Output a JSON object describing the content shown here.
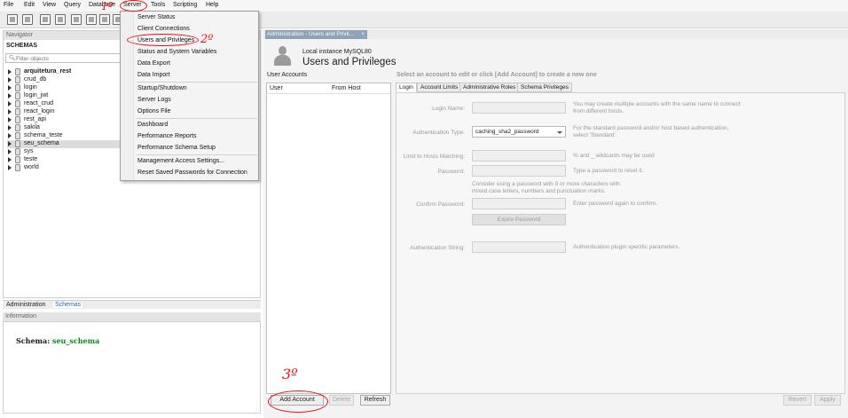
{
  "menubar": {
    "items": [
      "File",
      "Edit",
      "View",
      "Query",
      "Database",
      "Server",
      "Tools",
      "Scripting",
      "Help"
    ]
  },
  "server_menu": {
    "items": [
      "Server Status",
      "Client Connections",
      "Users and Privileges",
      "Status and System Variables",
      "Data Export",
      "Data Import",
      "Startup/Shutdown",
      "Server Logs",
      "Options File",
      "Dashboard",
      "Performance Reports",
      "Performance Schema Setup",
      "Management Access Settings...",
      "Reset Saved Passwords for Connection"
    ]
  },
  "navigator": {
    "header": "Navigator",
    "schemas_label": "SCHEMAS",
    "filter_placeholder": "Filter objects",
    "schemas": [
      "arquitetura_rest",
      "crud_db",
      "login",
      "login_jwt",
      "react_crud",
      "react_login",
      "rest_api",
      "sakila",
      "schema_teste",
      "seu_schema",
      "sys",
      "teste",
      "world"
    ],
    "active_schema": "arquitetura_rest",
    "selected_schema": "seu_schema"
  },
  "bottom_tabs": [
    "Administration",
    "Schemas"
  ],
  "info": {
    "header": "Information",
    "schema_label": "Schema:",
    "schema_value": "seu_schema"
  },
  "admin_tab": {
    "label": "Administration - Users and Privil...",
    "close": "×"
  },
  "users_page": {
    "instance": "Local instance MySQL80",
    "title": "Users and Privileges",
    "hint": "Select an account to edit or click [Add Account] to create a new one",
    "user_accounts_label": "User Accounts",
    "columns": [
      "User",
      "From Host"
    ],
    "detail_tabs": [
      "Login",
      "Account Limits",
      "Administrative Roles",
      "Schema Privileges"
    ],
    "fields": {
      "login_name": {
        "label": "Login Name:",
        "help": "You may create multiple accounts with the same name to connect from different hosts."
      },
      "auth_type": {
        "label": "Authentication Type:",
        "value": "caching_sha2_password",
        "help": "For the standard password and/or host based authentication, select 'Standard'."
      },
      "hosts": {
        "label": "Limit to Hosts Matching:",
        "help": "% and _ wildcards may be used"
      },
      "password": {
        "label": "Password:",
        "help": "Type a password to reset it."
      },
      "password_note": "Consider using a password with 8 or more characters with mixed case letters, numbers and punctuation marks.",
      "confirm": {
        "label": "Confirm Password:",
        "help": "Enter password again to confirm."
      },
      "expire_button": "Expire Password",
      "auth_string": {
        "label": "Authentication String:",
        "help": "Authentication plugin specific parameters."
      }
    },
    "buttons": {
      "add_account": "Add Account",
      "delete": "Delete",
      "refresh": "Refresh",
      "revert": "Revert",
      "apply": "Apply"
    }
  },
  "annotations": {
    "step1": "1º",
    "step2": "2º",
    "step3": "3º"
  },
  "colors": {
    "annotation": "#e11111",
    "schema_value": "#0a8a1a",
    "admin_tab": "#8ea3b8"
  }
}
